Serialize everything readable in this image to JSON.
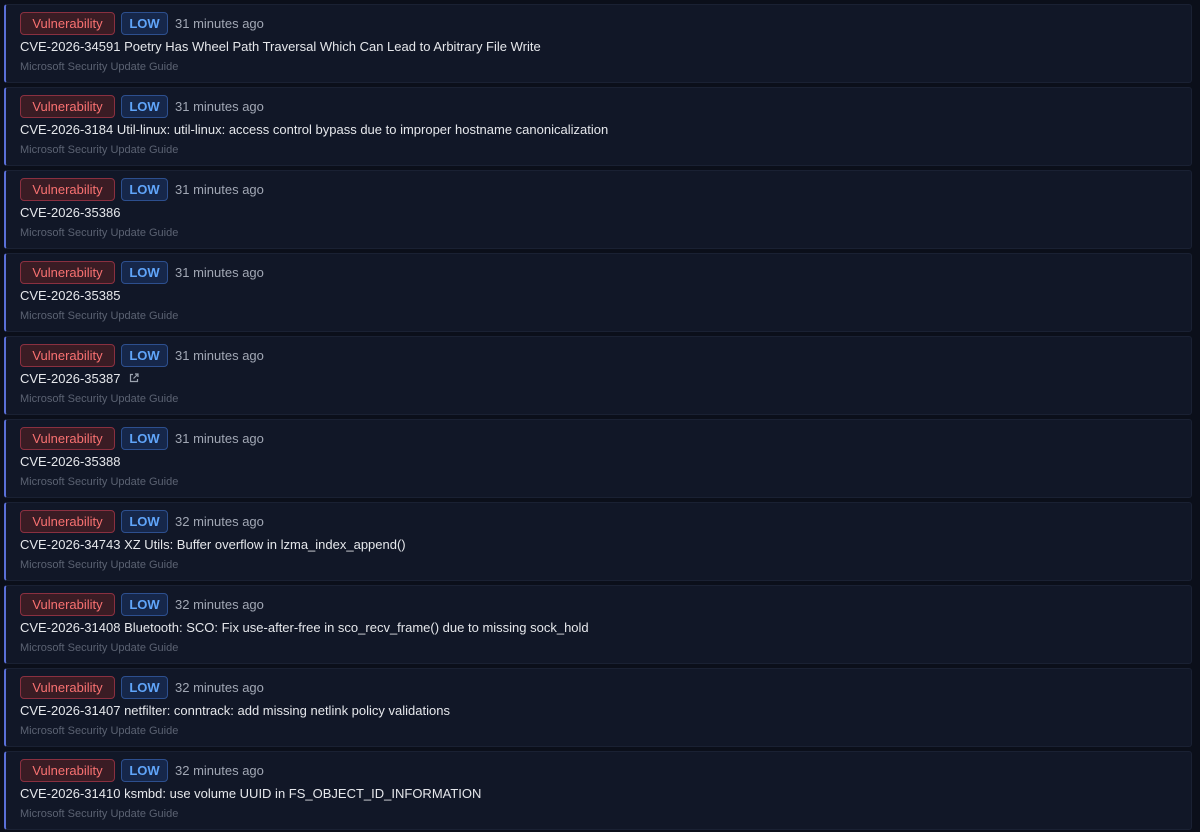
{
  "items": [
    {
      "type": "Vulnerability",
      "severity": "LOW",
      "time": "31 minutes ago",
      "title": "CVE-2026-34591 Poetry Has Wheel Path Traversal Which Can Lead to Arbitrary File Write",
      "source": "Microsoft Security Update Guide",
      "external": false
    },
    {
      "type": "Vulnerability",
      "severity": "LOW",
      "time": "31 minutes ago",
      "title": "CVE-2026-3184 Util-linux: util-linux: access control bypass due to improper hostname canonicalization",
      "source": "Microsoft Security Update Guide",
      "external": false
    },
    {
      "type": "Vulnerability",
      "severity": "LOW",
      "time": "31 minutes ago",
      "title": "CVE-2026-35386",
      "source": "Microsoft Security Update Guide",
      "external": false
    },
    {
      "type": "Vulnerability",
      "severity": "LOW",
      "time": "31 minutes ago",
      "title": "CVE-2026-35385",
      "source": "Microsoft Security Update Guide",
      "external": false
    },
    {
      "type": "Vulnerability",
      "severity": "LOW",
      "time": "31 minutes ago",
      "title": "CVE-2026-35387",
      "source": "Microsoft Security Update Guide",
      "external": true
    },
    {
      "type": "Vulnerability",
      "severity": "LOW",
      "time": "31 minutes ago",
      "title": "CVE-2026-35388",
      "source": "Microsoft Security Update Guide",
      "external": false
    },
    {
      "type": "Vulnerability",
      "severity": "LOW",
      "time": "32 minutes ago",
      "title": "CVE-2026-34743 XZ Utils: Buffer overflow in lzma_index_append()",
      "source": "Microsoft Security Update Guide",
      "external": false
    },
    {
      "type": "Vulnerability",
      "severity": "LOW",
      "time": "32 minutes ago",
      "title": "CVE-2026-31408 Bluetooth: SCO: Fix use-after-free in sco_recv_frame() due to missing sock_hold",
      "source": "Microsoft Security Update Guide",
      "external": false
    },
    {
      "type": "Vulnerability",
      "severity": "LOW",
      "time": "32 minutes ago",
      "title": "CVE-2026-31407 netfilter: conntrack: add missing netlink policy validations",
      "source": "Microsoft Security Update Guide",
      "external": false
    },
    {
      "type": "Vulnerability",
      "severity": "LOW",
      "time": "32 minutes ago",
      "title": "CVE-2026-31410 ksmbd: use volume UUID in FS_OBJECT_ID_INFORMATION",
      "source": "Microsoft Security Update Guide",
      "external": false
    }
  ],
  "colors": {
    "background": "#0b0f1a",
    "card": "#111727",
    "accent_border": "#5a6fd6",
    "type_badge_text": "#f87171",
    "severity_badge_text": "#60a5fa"
  },
  "icons": {
    "external_link": "external-link-icon"
  }
}
